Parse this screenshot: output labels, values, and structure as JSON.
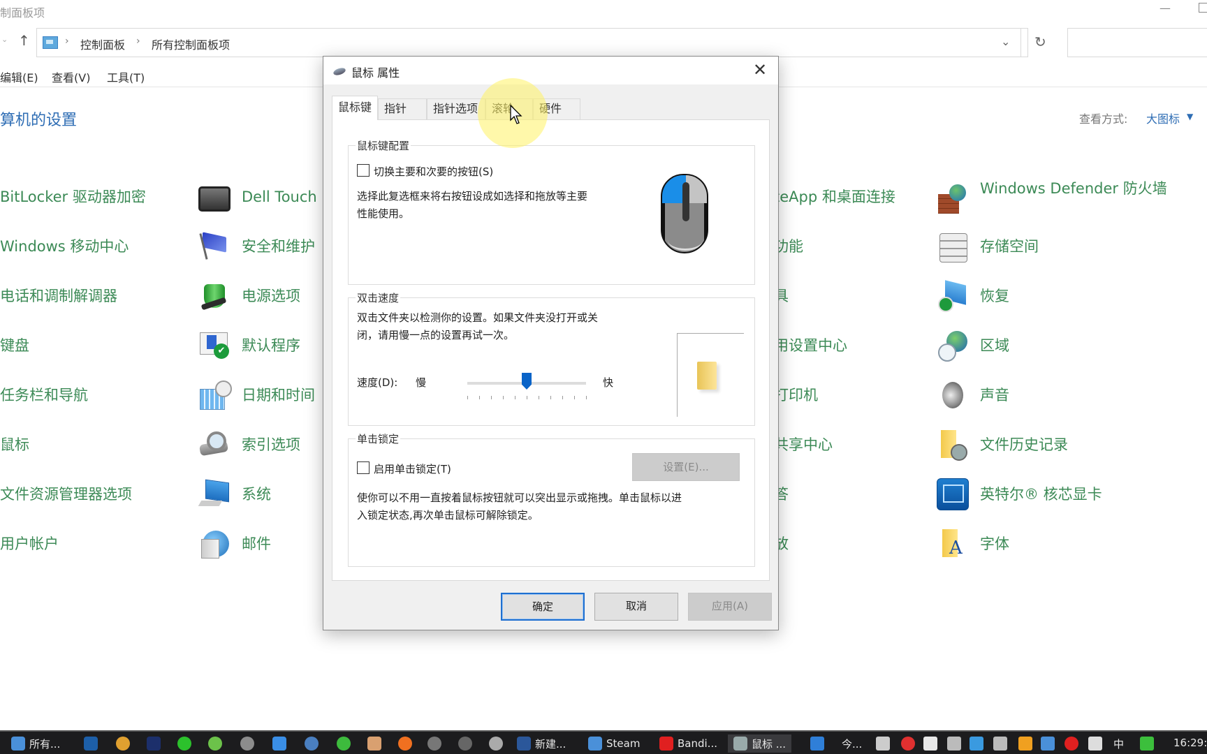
{
  "explorer": {
    "window_title_partial": "制面板项",
    "breadcrumb": [
      "控制面板",
      "所有控制面板项"
    ],
    "menu": [
      "编辑(E)",
      "查看(V)",
      "工具(T)"
    ],
    "heading_partial": "算机的设置",
    "view_by_label": "查看方式:",
    "view_by_value": "大图标",
    "items_col1": [
      "BitLocker 驱动器加密",
      "Windows 移动中心",
      "电话和调制解调器",
      "键盘",
      "任务栏和导航",
      "鼠标",
      "文件资源管理器选项",
      "用户帐户"
    ],
    "items_col2": [
      {
        "label": "Dell Touch",
        "icon": "monitor-icon"
      },
      {
        "label": "安全和维护",
        "icon": "flag-icon"
      },
      {
        "label": "电源选项",
        "icon": "power-icon"
      },
      {
        "label": "默认程序",
        "icon": "default-programs-icon"
      },
      {
        "label": "日期和时间",
        "icon": "calendar-clock-icon"
      },
      {
        "label": "索引选项",
        "icon": "index-icon"
      },
      {
        "label": "系统",
        "icon": "system-icon"
      },
      {
        "label": "邮件",
        "icon": "mail-icon"
      }
    ],
    "items_col3_partial": [
      "teApp 和桌面连接",
      "功能",
      "具",
      "用设置中心",
      "打印机",
      "共享中心",
      "答",
      "放"
    ],
    "items_col4": [
      {
        "label": "Windows Defender 防火墙",
        "icon": "firewall-icon"
      },
      {
        "label": "存储空间",
        "icon": "storage-icon"
      },
      {
        "label": "恢复",
        "icon": "recovery-icon"
      },
      {
        "label": "区域",
        "icon": "region-icon"
      },
      {
        "label": "声音",
        "icon": "speaker-icon"
      },
      {
        "label": "文件历史记录",
        "icon": "file-history-icon"
      },
      {
        "label": "英特尔® 核芯显卡",
        "icon": "intel-graphics-icon"
      },
      {
        "label": "字体",
        "icon": "fonts-icon"
      }
    ]
  },
  "dialog": {
    "title": "鼠标 属性",
    "tabs": [
      "鼠标键",
      "指针",
      "指针选项",
      "滚轮",
      "硬件"
    ],
    "active_tab": 0,
    "button_config": {
      "title": "鼠标键配置",
      "switch_label": "切换主要和次要的按钮(S)",
      "switch_checked": false,
      "desc_line1": "选择此复选框来将右按钮设成如选择和拖放等主要",
      "desc_line2": "性能使用。"
    },
    "double_click": {
      "title": "双击速度",
      "desc_line1": "双击文件夹以检测你的设置。如果文件夹没打开或关",
      "desc_line2": "闭，请用慢一点的设置再试一次。",
      "speed_label": "速度(D):",
      "slow_label": "慢",
      "fast_label": "快",
      "speed_value": 5,
      "speed_min": 0,
      "speed_max": 10
    },
    "click_lock": {
      "title": "单击锁定",
      "enable_label": "启用单击锁定(T)",
      "enable_checked": false,
      "settings_button": "设置(E)...",
      "desc_line1": "使你可以不用一直按着鼠标按钮就可以突出显示或拖拽。单击鼠标以进",
      "desc_line2": "入锁定状态,再次单击鼠标可解除锁定。"
    },
    "buttons": {
      "ok": "确定",
      "cancel": "取消",
      "apply": "应用(A)"
    }
  },
  "taskbar": {
    "items": [
      {
        "label": "所有...",
        "color": "#4a90d9"
      },
      {
        "label": "",
        "color": "#1d5fa8"
      },
      {
        "label": "",
        "color": "#e0a030"
      },
      {
        "label": "",
        "color": "#1c2f6b"
      },
      {
        "label": "",
        "color": "#2cc12c"
      },
      {
        "label": "",
        "color": "#6cc24a"
      },
      {
        "label": "",
        "color": "#8c8c8c"
      },
      {
        "label": "",
        "color": "#3a8ee6"
      },
      {
        "label": "",
        "color": "#4a7fc0"
      },
      {
        "label": "",
        "color": "#3dbb3d"
      },
      {
        "label": "",
        "color": "#d9a070"
      },
      {
        "label": "",
        "color": "#f07020"
      },
      {
        "label": "",
        "color": "#777777"
      },
      {
        "label": "",
        "color": "#666666"
      },
      {
        "label": "",
        "color": "#aaaaaa"
      },
      {
        "label": "新建...",
        "color": "#2b579a"
      },
      {
        "label": "Steam",
        "color": "#4a90d9"
      },
      {
        "label": "Bandi...",
        "color": "#e02020"
      },
      {
        "label": "鼠标 ...",
        "color": "#9aa"
      }
    ],
    "tray_news": "今...",
    "tray_ime": "中",
    "clock": "16:29:"
  }
}
